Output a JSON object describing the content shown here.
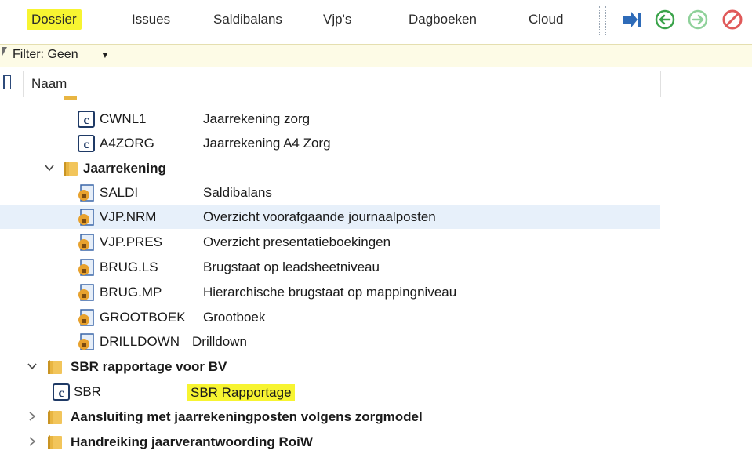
{
  "menu": {
    "items": [
      {
        "label": "Dossier",
        "active": true
      },
      {
        "label": "Issues"
      },
      {
        "label": "Saldibalans"
      },
      {
        "label": "Vjp's"
      },
      {
        "label": "Dagboeken"
      },
      {
        "label": "Cloud"
      }
    ],
    "highlight_color": "#f7f431"
  },
  "toolbar": {
    "buttons": [
      {
        "icon": "jump-to-icon",
        "color": "#2e6bb8"
      },
      {
        "icon": "back-arrow-icon",
        "color": "#3aa34a"
      },
      {
        "icon": "forward-arrow-icon",
        "color": "#8fd19a"
      },
      {
        "icon": "cancel-icon",
        "color": "#e05a5a"
      }
    ]
  },
  "filter": {
    "label": "Filter: Geen"
  },
  "columns": {
    "name": "Naam"
  },
  "tree": {
    "rows": [
      {
        "type": "report",
        "code": "CWNL1",
        "desc": "Jaarrekening zorg",
        "icon": "report-c-icon"
      },
      {
        "type": "report",
        "code": "A4ZORG",
        "desc": "Jaarrekening A4 Zorg",
        "icon": "report-c-icon"
      },
      {
        "type": "folder",
        "label": "Jaarrekening",
        "expanded": true
      },
      {
        "type": "report",
        "code": "SALDI",
        "desc": "Saldibalans",
        "icon": "report-lock-icon"
      },
      {
        "type": "report",
        "code": "VJP.NRM",
        "desc": "Overzicht voorafgaande journaalposten",
        "icon": "report-lock-icon",
        "selected": true
      },
      {
        "type": "report",
        "code": "VJP.PRES",
        "desc": "Overzicht presentatieboekingen",
        "icon": "report-lock-icon"
      },
      {
        "type": "report",
        "code": "BRUG.LS",
        "desc": "Brugstaat op leadsheetniveau",
        "icon": "report-lock-icon"
      },
      {
        "type": "report",
        "code": "BRUG.MP",
        "desc": "Hierarchische brugstaat op mappingniveau",
        "icon": "report-lock-icon"
      },
      {
        "type": "report",
        "code": "GROOTBOEK",
        "desc": "Grootboek",
        "icon": "report-lock-icon"
      },
      {
        "type": "report",
        "code": "DRILLDOWN",
        "desc": "Drilldown",
        "icon": "report-lock-icon"
      },
      {
        "type": "folder",
        "label": "SBR rapportage voor BV",
        "expanded": true
      },
      {
        "type": "report",
        "code": "SBR",
        "desc": "SBR Rapportage",
        "icon": "report-c-icon",
        "highlight": true
      },
      {
        "type": "folder",
        "label": "Aansluiting met jaarrekeningposten volgens zorgmodel",
        "expanded": false
      },
      {
        "type": "folder",
        "label": "Handreiking jaarverantwoording RoiW",
        "expanded": false
      }
    ]
  }
}
